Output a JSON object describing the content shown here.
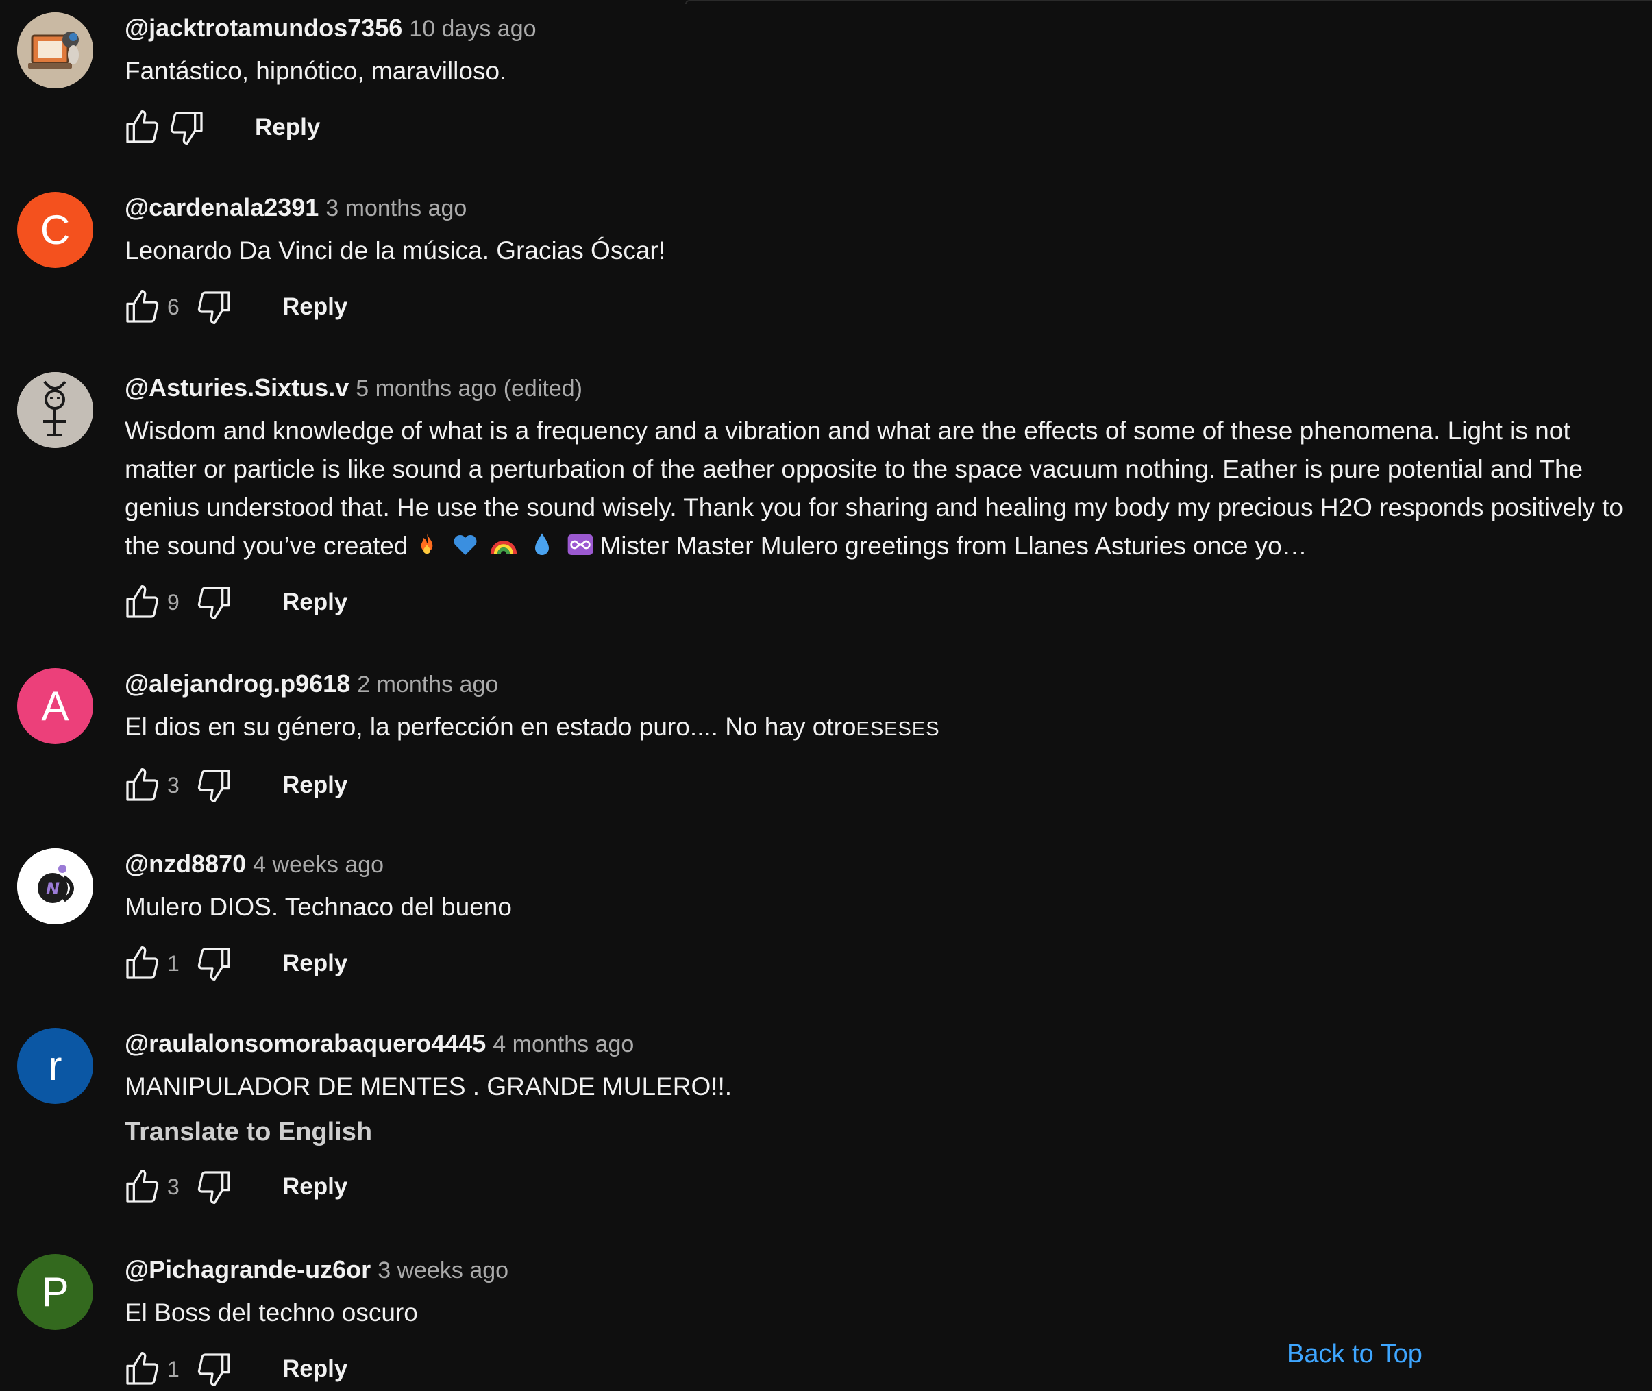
{
  "comments": [
    {
      "author": "@jacktrotamundos7356",
      "time": "10 days ago",
      "text": "Fantástico, hipnótico, maravilloso.",
      "likes": "",
      "reply_label": "Reply",
      "avatar": {
        "type": "image",
        "icon": "laptop-avatar",
        "bg": "#c9b9a3"
      }
    },
    {
      "author": "@cardenala2391",
      "time": "3 months ago",
      "text": "Leonardo Da Vinci de la música. Gracias Óscar!",
      "likes": "6",
      "reply_label": "Reply",
      "avatar": {
        "type": "letter",
        "letter": "C",
        "bg": "#f4511e"
      }
    },
    {
      "author": "@Asturies.Sixtus.v",
      "time": "5 months ago (edited)",
      "text_before_emoji": "Wisdom and knowledge of what is a frequency and a vibration and what are the effects of some of these phenomena. Light is not matter or particle is like sound a perturbation of the aether opposite to the space vacuum nothing. Eather is pure potential and The genius understood that. He use the sound wisely. Thank you for sharing and healing my body my precious H2O responds positively to the sound you’ve created",
      "emojis": [
        "fire-emoji",
        "blue-heart-emoji",
        "rainbow-emoji",
        "droplet-emoji",
        "infinity-emoji"
      ],
      "text_after_emoji": "Mister Master Mulero greetings from Llanes Asturies once yo…",
      "likes": "9",
      "reply_label": "Reply",
      "avatar": {
        "type": "image",
        "icon": "mercury-symbol-avatar",
        "bg": "#c4beb6"
      }
    },
    {
      "author": "@alejandrog.p9618",
      "time": "2 months ago",
      "text": "El dios en su género, la perfección en estado puro.... No hay otro",
      "text_smallcaps": "ESESES",
      "likes": "3",
      "reply_label": "Reply",
      "avatar": {
        "type": "letter",
        "letter": "A",
        "bg": "#ec407a"
      }
    },
    {
      "author": "@nzd8870",
      "time": "4 weeks ago",
      "text": "Mulero DIOS. Technaco del bueno",
      "likes": "1",
      "reply_label": "Reply",
      "avatar": {
        "type": "image",
        "icon": "n-logo-avatar",
        "bg": "#ffffff"
      }
    },
    {
      "author": "@raulalonsomorabaquero4445",
      "time": "4 months ago",
      "text": "MANIPULADOR DE MENTES . GRANDE MULERO!!.",
      "translate_label": "Translate to English",
      "likes": "3",
      "reply_label": "Reply",
      "avatar": {
        "type": "letter",
        "letter": "r",
        "bg": "#0b57a4"
      }
    },
    {
      "author": "@Pichagrande-uz6or",
      "time": "3 weeks ago",
      "text": "El Boss del techno oscuro",
      "likes": "1",
      "reply_label": "Reply",
      "avatar": {
        "type": "letter",
        "letter": "P",
        "bg": "#33691e"
      }
    }
  ],
  "back_to_top": "Back to Top",
  "colors": {
    "background": "#0f0f0f",
    "text": "#f1f1f1",
    "muted": "#aaaaaa",
    "link": "#3ea6ff"
  }
}
